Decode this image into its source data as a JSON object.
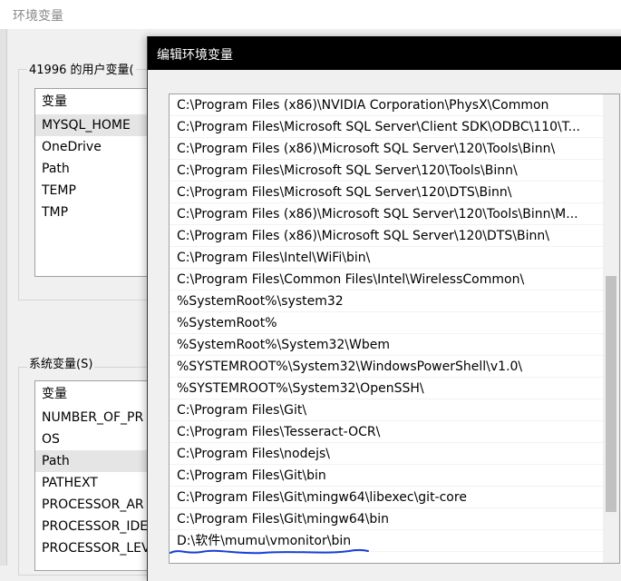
{
  "bg_window": {
    "title": "环境变量",
    "user_group_label": "41996 的用户变量(",
    "user_vars": {
      "header": "变量",
      "items": [
        "MYSQL_HOME",
        "OneDrive",
        "Path",
        "TEMP",
        "TMP"
      ],
      "selected": "MYSQL_HOME"
    },
    "system_group_label": "系统变量(S)",
    "system_vars": {
      "header": "变量",
      "items": [
        "NUMBER_OF_PR",
        "OS",
        "Path",
        "PATHEXT",
        "PROCESSOR_AR",
        "PROCESSOR_IDE",
        "PROCESSOR_LEV"
      ],
      "selected": "Path"
    }
  },
  "dialog": {
    "title": "编辑环境变量",
    "paths": [
      "C:\\Program Files (x86)\\NVIDIA Corporation\\PhysX\\Common",
      "C:\\Program Files\\Microsoft SQL Server\\Client SDK\\ODBC\\110\\T...",
      "C:\\Program Files (x86)\\Microsoft SQL Server\\120\\Tools\\Binn\\",
      "C:\\Program Files\\Microsoft SQL Server\\120\\Tools\\Binn\\",
      "C:\\Program Files\\Microsoft SQL Server\\120\\DTS\\Binn\\",
      "C:\\Program Files (x86)\\Microsoft SQL Server\\120\\Tools\\Binn\\M...",
      "C:\\Program Files (x86)\\Microsoft SQL Server\\120\\DTS\\Binn\\",
      "C:\\Program Files\\Intel\\WiFi\\bin\\",
      "C:\\Program Files\\Common Files\\Intel\\WirelessCommon\\",
      "%SystemRoot%\\system32",
      "%SystemRoot%",
      "%SystemRoot%\\System32\\Wbem",
      "%SYSTEMROOT%\\System32\\WindowsPowerShell\\v1.0\\",
      "%SYSTEMROOT%\\System32\\OpenSSH\\",
      "C:\\Program Files\\Git\\",
      "C:\\Program Files\\Tesseract-OCR\\",
      "C:\\Program Files\\nodejs\\",
      "C:\\Program Files\\Git\\bin",
      "C:\\Program Files\\Git\\mingw64\\libexec\\git-core",
      "C:\\Program Files\\Git\\mingw64\\bin",
      "D:\\软件\\mumu\\vmonitor\\bin"
    ],
    "highlighted_path": "D:\\软件\\mumu\\vmonitor\\bin",
    "annotation_color": "#1a3fd6"
  }
}
